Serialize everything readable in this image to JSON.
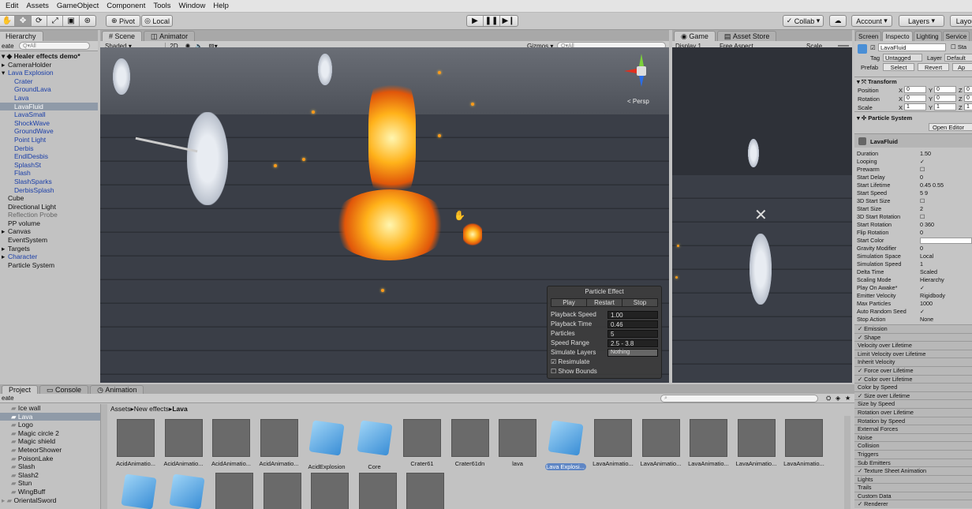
{
  "menu": [
    "Edit",
    "Assets",
    "GameObject",
    "Component",
    "Tools",
    "Window",
    "Help"
  ],
  "toolbar": {
    "pivot": "Pivot",
    "local": "Local",
    "collab": "Collab",
    "account": "Account",
    "layers": "Layers",
    "layout": "Layou"
  },
  "hierarchy": {
    "tab": "Hierarchy",
    "create": "eate",
    "search_placeholder": "Q▾All",
    "scene_name": "Healer effects demo*",
    "items": [
      {
        "label": "CameraHolder",
        "style": "",
        "indent": 1,
        "arrow": "▸"
      },
      {
        "label": "Lava Explosion",
        "style": "blue",
        "indent": 1,
        "arrow": "▾"
      },
      {
        "label": "Crater",
        "style": "blue",
        "indent": 2,
        "arrow": ""
      },
      {
        "label": "GroundLava",
        "style": "blue",
        "indent": 2,
        "arrow": ""
      },
      {
        "label": "Lava",
        "style": "blue",
        "indent": 2,
        "arrow": ""
      },
      {
        "label": "LavaFluid",
        "style": "sel",
        "indent": 2,
        "arrow": ""
      },
      {
        "label": "LavaSmall",
        "style": "blue",
        "indent": 2,
        "arrow": ""
      },
      {
        "label": "ShockWave",
        "style": "blue",
        "indent": 2,
        "arrow": ""
      },
      {
        "label": "GroundWave",
        "style": "blue",
        "indent": 2,
        "arrow": ""
      },
      {
        "label": "Point Light",
        "style": "blue",
        "indent": 2,
        "arrow": ""
      },
      {
        "label": "Derbis",
        "style": "blue",
        "indent": 2,
        "arrow": ""
      },
      {
        "label": "EndlDesbis",
        "style": "blue",
        "indent": 2,
        "arrow": ""
      },
      {
        "label": "SplashSt",
        "style": "blue",
        "indent": 2,
        "arrow": ""
      },
      {
        "label": "Flash",
        "style": "blue",
        "indent": 2,
        "arrow": ""
      },
      {
        "label": "SlashSparks",
        "style": "blue",
        "indent": 2,
        "arrow": ""
      },
      {
        "label": "DerbisSplash",
        "style": "blue",
        "indent": 2,
        "arrow": ""
      },
      {
        "label": "Cube",
        "style": "",
        "indent": 1,
        "arrow": ""
      },
      {
        "label": "Directional Light",
        "style": "",
        "indent": 1,
        "arrow": ""
      },
      {
        "label": "Reflection Probe",
        "style": "gray",
        "indent": 1,
        "arrow": ""
      },
      {
        "label": "PP volume",
        "style": "",
        "indent": 1,
        "arrow": ""
      },
      {
        "label": "Canvas",
        "style": "",
        "indent": 1,
        "arrow": "▸"
      },
      {
        "label": "EventSystem",
        "style": "",
        "indent": 1,
        "arrow": ""
      },
      {
        "label": "Targets",
        "style": "",
        "indent": 1,
        "arrow": "▸"
      },
      {
        "label": "Character",
        "style": "blue",
        "indent": 1,
        "arrow": "▸"
      },
      {
        "label": "Particle System",
        "style": "",
        "indent": 1,
        "arrow": ""
      }
    ]
  },
  "scene": {
    "tab_scene": "Scene",
    "tab_animator": "Animator",
    "shading": "Shaded",
    "mode_2d": "2D",
    "gizmos": "Gizmos ▾",
    "search_placeholder": "Q▾All",
    "persp": "< Persp"
  },
  "particle_effect": {
    "title": "Particle Effect",
    "play": "Play",
    "restart": "Restart",
    "stop": "Stop",
    "rows": [
      {
        "k": "Playback Speed",
        "v": "1.00"
      },
      {
        "k": "Playback Time",
        "v": "0.46"
      },
      {
        "k": "Particles",
        "v": "5"
      },
      {
        "k": "Speed Range",
        "v": "2.5 - 3.8"
      },
      {
        "k": "Simulate Layers",
        "v": "Nothing"
      }
    ],
    "resimulate": "Resimulate",
    "show_bounds": "Show Bounds"
  },
  "game": {
    "tab_game": "Game",
    "tab_store": "Asset Store",
    "display": "Display 1",
    "aspect": "Free Aspect",
    "scale": "Scale"
  },
  "inspector": {
    "tabs": [
      "Screen",
      "Inspecto",
      "Lighting",
      "Service"
    ],
    "object_name": "LavaFluid",
    "static": "Sta",
    "tag_label": "Tag",
    "tag": "Untagged",
    "layer_label": "Layer",
    "layer": "Default",
    "prefab_label": "Prefab",
    "prefab_select": "Select",
    "prefab_revert": "Revert",
    "prefab_apply": "Ap",
    "transform_title": "Transform",
    "position_label": "Position",
    "rotation_label": "Rotation",
    "scale_label": "Scale",
    "position": [
      "0",
      "0",
      "0"
    ],
    "rotation": [
      "0",
      "0",
      "0"
    ],
    "scale": [
      "1",
      "1",
      "1"
    ],
    "ps_title": "Particle System",
    "open_editor": "Open Editor",
    "ps_name": "LavaFluid",
    "props": [
      {
        "k": "Duration",
        "v": "1.50"
      },
      {
        "k": "Looping",
        "v": "✓"
      },
      {
        "k": "Prewarm",
        "v": "☐"
      },
      {
        "k": "Start Delay",
        "v": "0"
      },
      {
        "k": "Start Lifetime",
        "v": "0.45            0.55"
      },
      {
        "k": "Start Speed",
        "v": "5                  9"
      },
      {
        "k": "3D Start Size",
        "v": "☐"
      },
      {
        "k": "Start Size",
        "v": "2"
      },
      {
        "k": "3D Start Rotation",
        "v": "☐"
      },
      {
        "k": "Start Rotation",
        "v": "0                  360"
      },
      {
        "k": "Flip Rotation",
        "v": "0"
      },
      {
        "k": "Start Color",
        "v": ""
      },
      {
        "k": "Gravity Modifier",
        "v": "0"
      },
      {
        "k": "Simulation Space",
        "v": "Local"
      },
      {
        "k": "Simulation Speed",
        "v": "1"
      },
      {
        "k": "Delta Time",
        "v": "Scaled"
      },
      {
        "k": "Scaling Mode",
        "v": "Hierarchy"
      },
      {
        "k": "Play On Awake*",
        "v": "✓"
      },
      {
        "k": "Emitter Velocity",
        "v": "Rigidbody"
      },
      {
        "k": "Max Particles",
        "v": "1000"
      },
      {
        "k": "Auto Random Seed",
        "v": "✓"
      },
      {
        "k": "Stop Action",
        "v": "None"
      }
    ],
    "modules": [
      "✓ Emission",
      "✓ Shape",
      "  Velocity over Lifetime",
      "  Limit Velocity over Lifetime",
      "  Inherit Velocity",
      "✓ Force over Lifetime",
      "✓ Color over Lifetime",
      "  Color by Speed",
      "✓ Size over Lifetime",
      "  Size by Speed",
      "  Rotation over Lifetime",
      "  Rotation by Speed",
      "  External Forces",
      "  Noise",
      "  Collision",
      "  Triggers",
      "  Sub Emitters",
      "✓ Texture Sheet Animation",
      "  Lights",
      "  Trails",
      "  Custom Data",
      "✓ Renderer"
    ]
  },
  "project": {
    "tab_project": "Project",
    "tab_console": "Console",
    "tab_animation": "Animation",
    "create": "eate",
    "folders": [
      {
        "label": "Ice wall",
        "sel": false
      },
      {
        "label": "Lava",
        "sel": true
      },
      {
        "label": "Logo",
        "sel": false
      },
      {
        "label": "Magic circle 2",
        "sel": false
      },
      {
        "label": "Magic shield",
        "sel": false
      },
      {
        "label": "MeteorShower",
        "sel": false
      },
      {
        "label": "PoisonLake",
        "sel": false
      },
      {
        "label": "Slash",
        "sel": false
      },
      {
        "label": "Slash2",
        "sel": false
      },
      {
        "label": "Stun",
        "sel": false
      },
      {
        "label": "WingBuff",
        "sel": false
      },
      {
        "label": "OrientalSword",
        "sel": false
      }
    ],
    "breadcrumb": [
      "Assets",
      "New effects",
      "Lava"
    ],
    "assets_row1": [
      {
        "label": "AcidAnimatio...",
        "kind": "dots"
      },
      {
        "label": "AcidAnimatio...",
        "kind": "dots-dark"
      },
      {
        "label": "AcidAnimatio...",
        "kind": "dots"
      },
      {
        "label": "AcidAnimatio...",
        "kind": "dots-dark"
      },
      {
        "label": "AcidExplosion",
        "kind": "cube"
      },
      {
        "label": "Core",
        "kind": "cube"
      },
      {
        "label": "Crater61",
        "kind": "burst"
      },
      {
        "label": "Crater61dn",
        "kind": "burst"
      },
      {
        "label": "lava",
        "kind": "dots-orange-dark"
      },
      {
        "label": "Lava Explosi...",
        "kind": "cube"
      },
      {
        "label": "LavaAnimatio...",
        "kind": "dots-orange"
      },
      {
        "label": "LavaAnimatio...",
        "kind": "dots-orange-dark"
      },
      {
        "label": "LavaAnimatio...",
        "kind": "dots-orange"
      },
      {
        "label": "LavaAnimatio...",
        "kind": "dots-orange-dark"
      },
      {
        "label": "LavaAnimatio...",
        "kind": "dots-orange"
      }
    ],
    "assets_row2": [
      {
        "kind": "cube"
      },
      {
        "kind": "cube"
      },
      {
        "kind": "dots-white"
      },
      {
        "kind": "dots-dark"
      },
      {
        "kind": "dots-white"
      },
      {
        "kind": "dots-dark"
      },
      {
        "kind": "dots-white"
      }
    ]
  }
}
